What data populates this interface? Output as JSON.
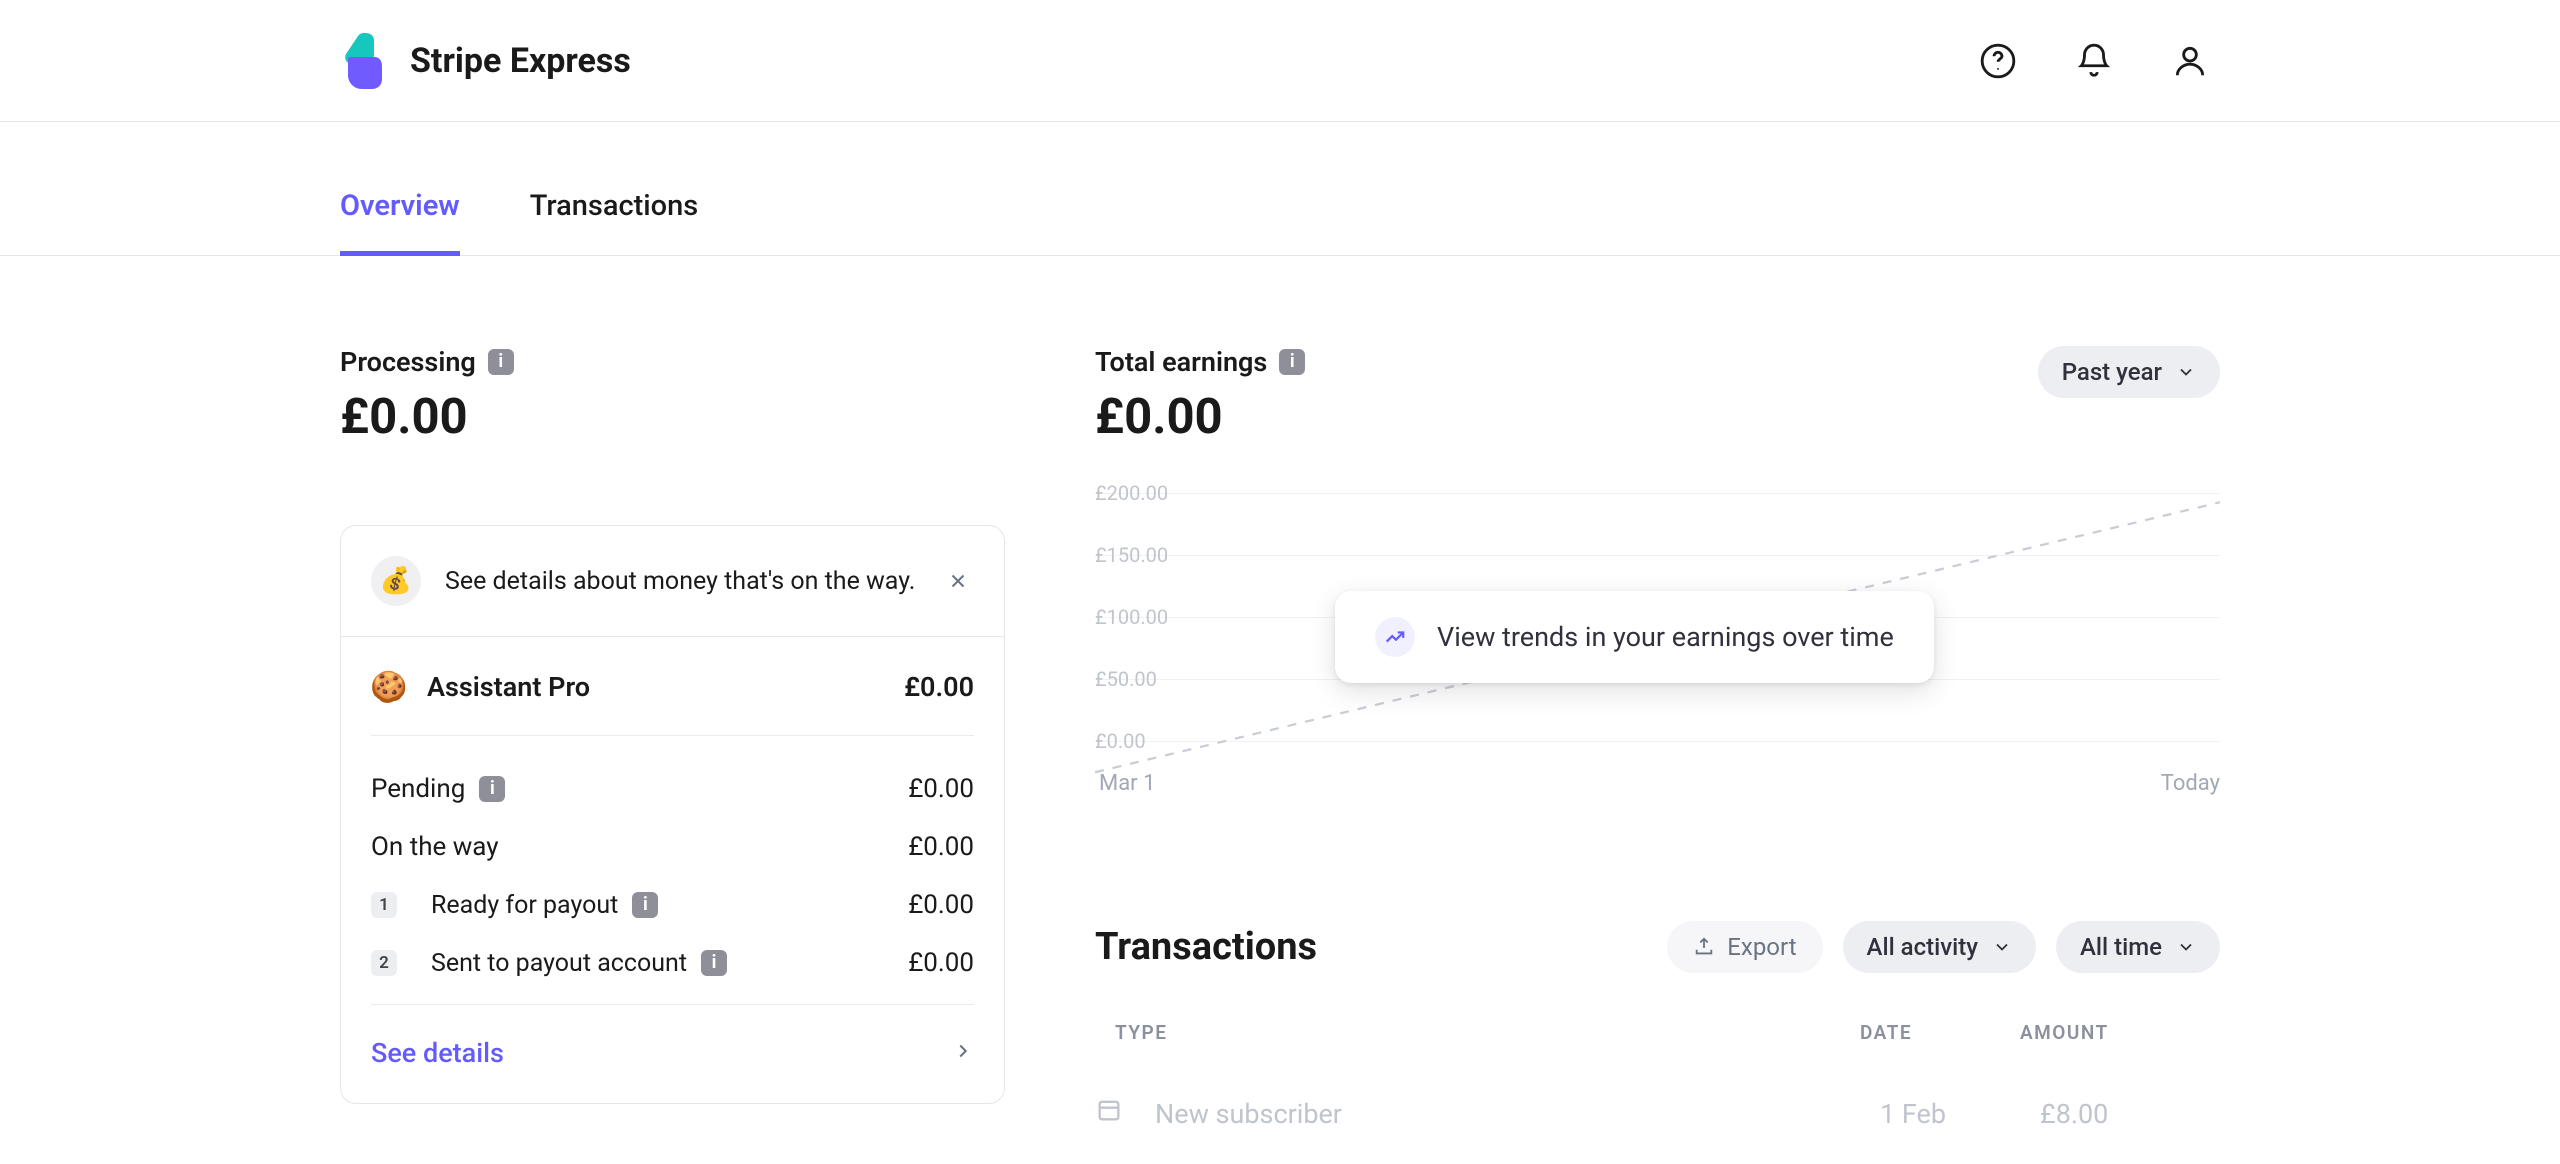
{
  "brand": {
    "name": "Stripe Express"
  },
  "tabs": {
    "overview": "Overview",
    "transactions": "Transactions"
  },
  "processing": {
    "label": "Processing",
    "value": "£0.00"
  },
  "earnings": {
    "label": "Total earnings",
    "value": "£0.00",
    "period_selected": "Past year"
  },
  "card": {
    "banner_text": "See details about money that's on the way.",
    "account_name": "Assistant Pro",
    "account_amount": "£0.00",
    "pending_label": "Pending",
    "pending_value": "£0.00",
    "ontheway_label": "On the way",
    "ontheway_value": "£0.00",
    "step1_label": "Ready for payout",
    "step1_value": "£0.00",
    "step2_label": "Sent to payout account",
    "step2_value": "£0.00",
    "see_details": "See details"
  },
  "chart_data": {
    "type": "line",
    "title": "",
    "xlabel": "",
    "ylabel": "",
    "ylim": [
      0,
      200
    ],
    "y_ticks": [
      "£200.00",
      "£150.00",
      "£100.00",
      "£50.00",
      "£0.00"
    ],
    "x_ticks": [
      "Mar 1",
      "Today"
    ],
    "series": [
      {
        "name": "earnings",
        "values": [
          0,
          0,
          0,
          0,
          0
        ]
      }
    ],
    "callout": "View trends in your earnings over time"
  },
  "tx": {
    "title": "Transactions",
    "export_label": "Export",
    "filter_activity": "All activity",
    "filter_time": "All time",
    "col_type": "TYPE",
    "col_date": "DATE",
    "col_amount": "AMOUNT",
    "rows": [
      {
        "desc": "New subscriber",
        "date": "1 Feb",
        "amount": "£8.00"
      }
    ]
  },
  "icons": {
    "info": "i",
    "money_bag": "💰",
    "cookie": "🍪"
  }
}
